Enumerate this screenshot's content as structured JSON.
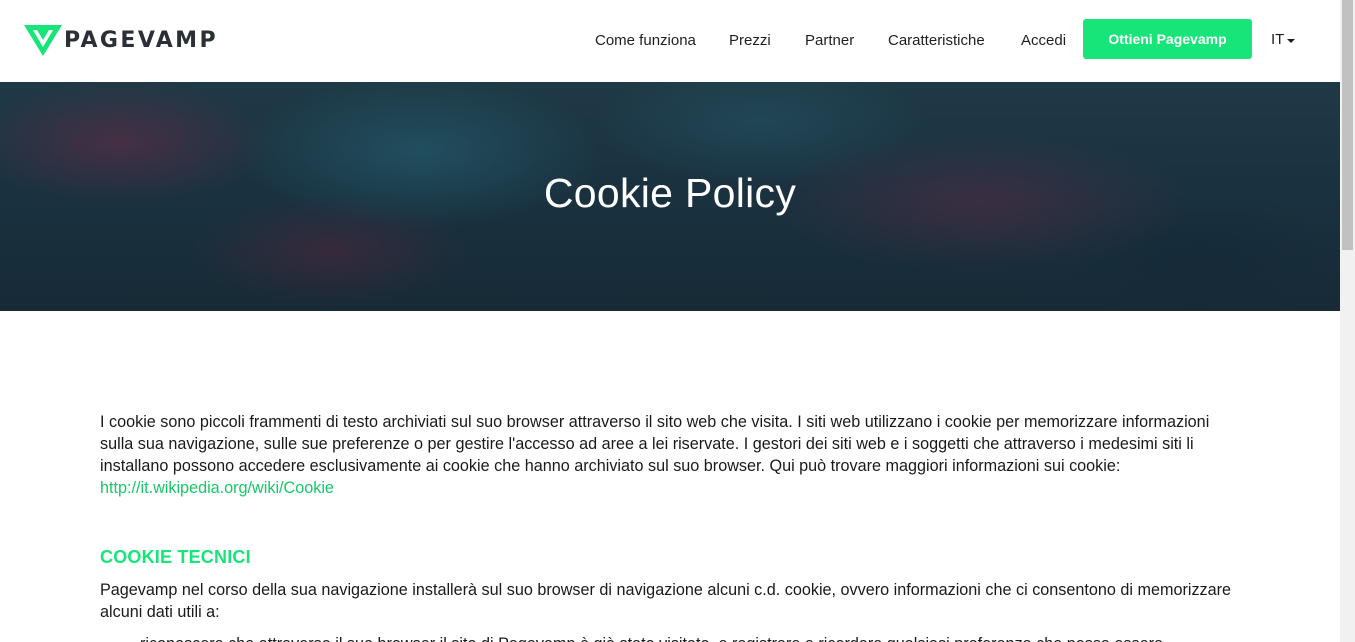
{
  "header": {
    "logo_text": "PAGEVAMP",
    "nav": [
      {
        "label": "Come funziona"
      },
      {
        "label": "Prezzi"
      },
      {
        "label": "Partner"
      },
      {
        "label": "Caratteristiche"
      },
      {
        "label": "Accedi"
      }
    ],
    "cta_label": "Ottieni Pagevamp",
    "language": "IT"
  },
  "hero": {
    "title": "Cookie Policy"
  },
  "content": {
    "intro_text": "I cookie sono piccoli frammenti di testo archiviati sul suo browser attraverso il sito web che visita. I siti web utilizzano i cookie per memorizzare informazioni sulla sua navigazione, sulle sue preferenze o per gestire l'accesso ad aree a lei riservate. I gestori dei siti web e i soggetti che attraverso i medesimi siti li installano possono accedere esclusivamente ai cookie che hanno archiviato sul suo browser. Qui può trovare maggiori informazioni sui cookie: ",
    "intro_link": "http://it.wikipedia.org/wiki/Cookie",
    "section_title": "COOKIE TECNICI",
    "section_text": "Pagevamp nel corso della sua navigazione installerà sul suo browser di navigazione alcuni c.d. cookie, ovvero informazioni che ci consentono di memorizzare alcuni dati utili a:",
    "list_items": [
      "riconoscere che attraverso il suo browser il sito di Pagevamp è già stato visitato, e registrare e ricordare qualsiasi preferenza che possa essere"
    ]
  },
  "colors": {
    "accent": "#17e57a",
    "link": "#17c968",
    "hero_bg": "#1a3240"
  }
}
